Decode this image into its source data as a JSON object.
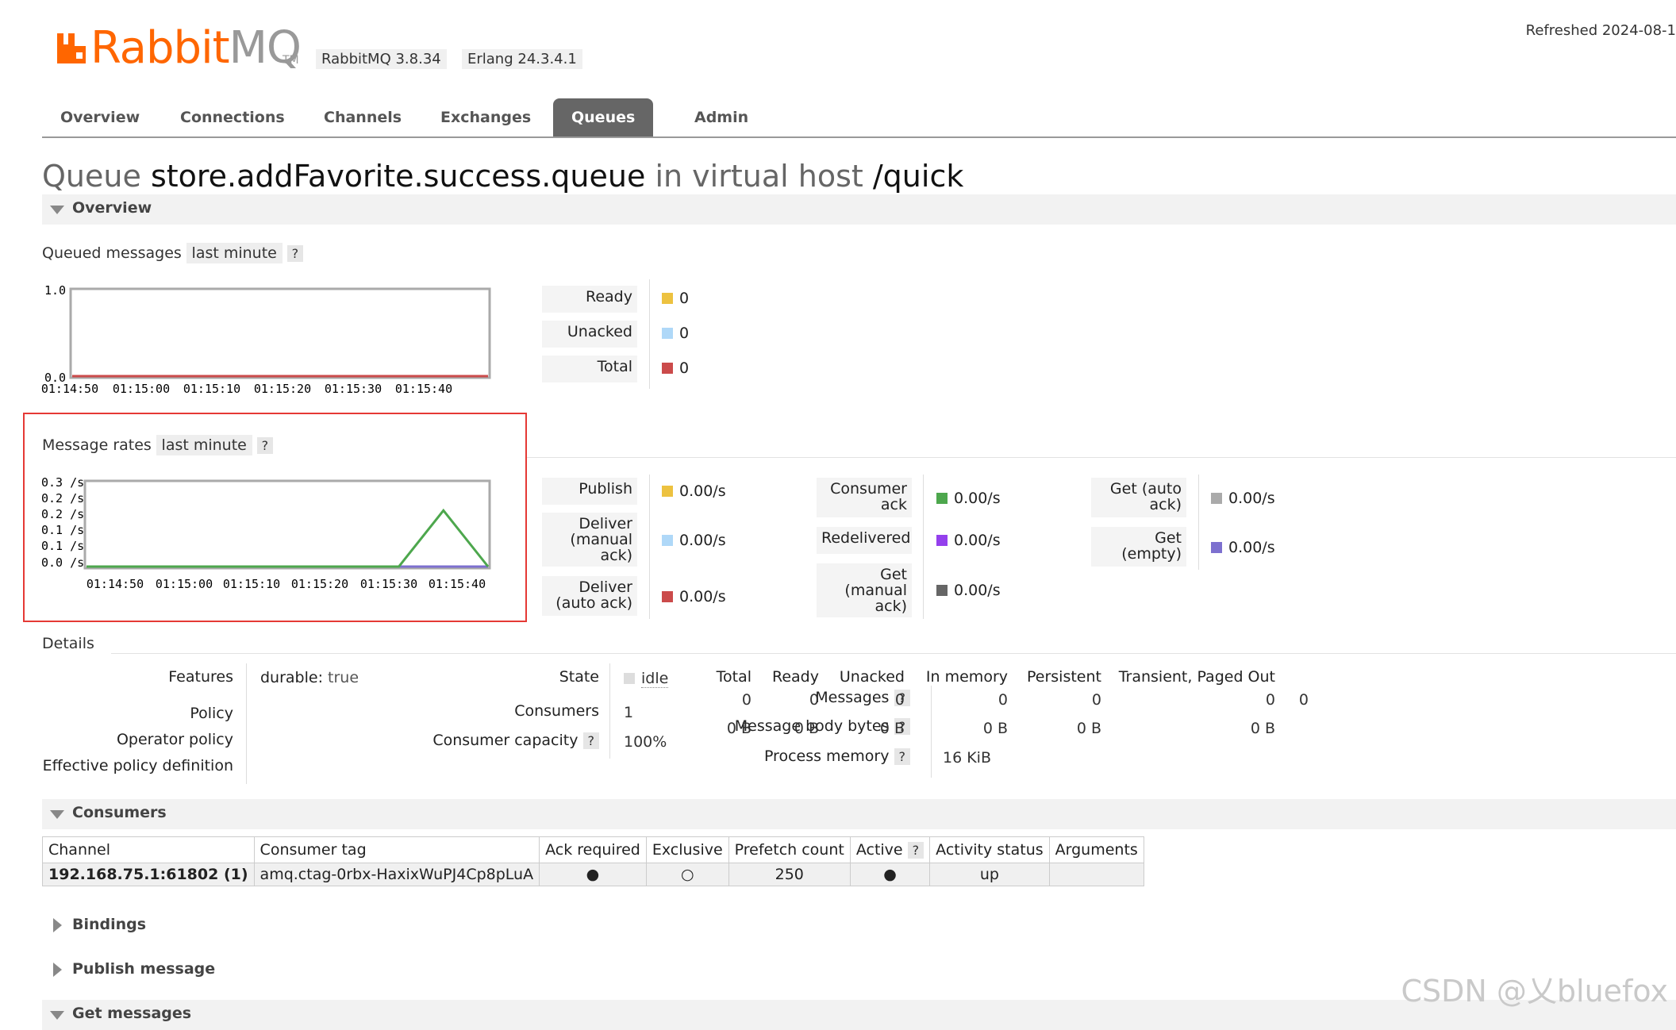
{
  "header": {
    "logo_rabbit": "Rabbit",
    "logo_mq": "MQ",
    "logo_tm": "TM",
    "version_rabbit": "RabbitMQ 3.8.34",
    "version_erlang": "Erlang 24.3.4.1",
    "refreshed": "Refreshed 2024-08-1"
  },
  "tabs": [
    "Overview",
    "Connections",
    "Channels",
    "Exchanges",
    "Queues",
    "Admin"
  ],
  "title": {
    "prefix": "Queue",
    "queue": "store.addFavorite.success.queue",
    "mid": "in virtual host",
    "vhost": "/quick"
  },
  "overview": {
    "section": "Overview",
    "queued_label": "Queued messages",
    "queued_range": "last minute",
    "help": "?",
    "rates_label": "Message rates",
    "rates_range": "last minute"
  },
  "queued_legend": [
    {
      "label": "Ready",
      "value": "0",
      "color": "#edc240"
    },
    {
      "label": "Unacked",
      "value": "0",
      "color": "#afd8f8"
    },
    {
      "label": "Total",
      "value": "0",
      "color": "#cb4b4b"
    }
  ],
  "rates_legend_col1": [
    {
      "label": "Publish",
      "value": "0.00/s",
      "color": "#edc240"
    },
    {
      "label": "Deliver (manual ack)",
      "value": "0.00/s",
      "color": "#afd8f8"
    },
    {
      "label": "Deliver (auto ack)",
      "value": "0.00/s",
      "color": "#cb4b4b"
    }
  ],
  "rates_legend_col2": [
    {
      "label": "Consumer ack",
      "value": "0.00/s",
      "color": "#4da74d"
    },
    {
      "label": "Redelivered",
      "value": "0.00/s",
      "color": "#9440ed"
    },
    {
      "label": "Get (manual ack)",
      "value": "0.00/s",
      "color": "#666666"
    }
  ],
  "rates_legend_col3": [
    {
      "label": "Get (auto ack)",
      "value": "0.00/s",
      "color": "#aaaaaa"
    },
    {
      "label": "Get (empty)",
      "value": "0.00/s",
      "color": "#7d70cf"
    }
  ],
  "chart_data": [
    {
      "type": "line",
      "x": [
        "01:14:50",
        "01:15:00",
        "01:15:10",
        "01:15:20",
        "01:15:30",
        "01:15:40"
      ],
      "yticks": [
        "1.0",
        "0.0"
      ],
      "ylim": [
        0,
        1
      ],
      "series": [
        {
          "name": "Total",
          "color": "#cb4b4b",
          "values": [
            0,
            0,
            0,
            0,
            0,
            0,
            0
          ]
        }
      ]
    },
    {
      "type": "line",
      "x": [
        "01:14:50",
        "01:15:00",
        "01:15:10",
        "01:15:20",
        "01:15:30",
        "01:15:40"
      ],
      "yticks": [
        "0.3 /s",
        "0.2 /s",
        "0.2 /s",
        "0.1 /s",
        "0.1 /s",
        "0.0 /s"
      ],
      "ylim": [
        0,
        0.3
      ],
      "series": [
        {
          "name": "Consumer ack",
          "color": "#4da74d",
          "values": [
            0,
            0,
            0,
            0,
            0,
            0,
            0,
            0,
            0.2,
            0
          ]
        },
        {
          "name": "Get (empty)",
          "color": "#7d70cf",
          "values": [
            0,
            0,
            0,
            0,
            0,
            0,
            0,
            0,
            0,
            0
          ]
        }
      ]
    }
  ],
  "details": {
    "section": "Details",
    "features_label": "Features",
    "features_key": "durable:",
    "features_val": "true",
    "policy_label": "Policy",
    "operator_policy_label": "Operator policy",
    "effective_policy_label": "Effective policy definition",
    "state_label": "State",
    "state_val": "idle",
    "consumers_label": "Consumers",
    "consumers_val": "1",
    "capacity_label": "Consumer capacity",
    "capacity_val": "100%",
    "cols": [
      "Total",
      "Ready",
      "Unacked",
      "In memory",
      "Persistent",
      "Transient, Paged Out"
    ],
    "messages_label": "Messages",
    "messages_vals": [
      "0",
      "0",
      "0",
      "0",
      "0",
      "0",
      "0"
    ],
    "body_label": "Message body bytes",
    "body_vals": [
      "0 B",
      "0 B",
      "0 B",
      "0 B",
      "0 B",
      "0 B"
    ],
    "process_label": "Process memory",
    "process_val": "16 KiB"
  },
  "consumers": {
    "section": "Consumers",
    "headers": [
      "Channel",
      "Consumer tag",
      "Ack required",
      "Exclusive",
      "Prefetch count",
      "Active",
      "Activity status",
      "Arguments"
    ],
    "row": {
      "channel": "192.168.75.1:61802 (1)",
      "tag": "amq.ctag-0rbx-HaxixWuPJ4Cp8pLuA",
      "ack": "●",
      "exclusive": "○",
      "prefetch": "250",
      "active": "●",
      "status": "up",
      "arguments": ""
    }
  },
  "sections_collapsed": [
    "Bindings",
    "Publish message",
    "Get messages"
  ],
  "watermark": "CSDN @乂bluefox"
}
